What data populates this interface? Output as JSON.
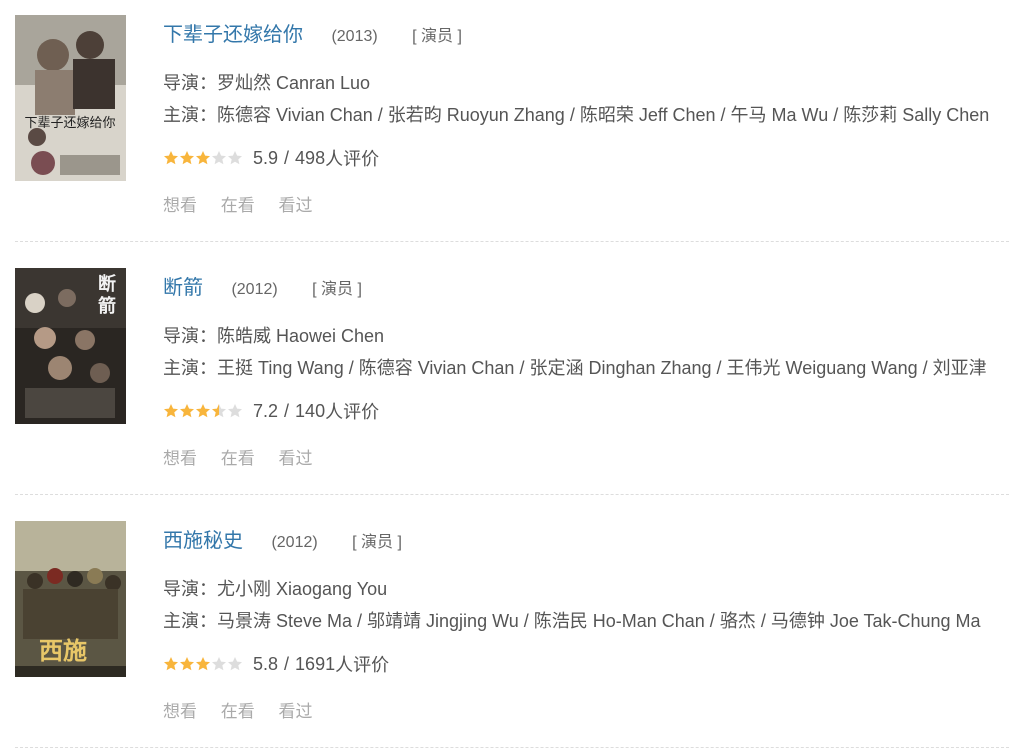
{
  "labels": {
    "director_prefix": "导演：",
    "cast_prefix": "主演：",
    "slash": "/",
    "rating_suffix": "人评价",
    "want": "想看",
    "watching": "在看",
    "watched": "看过"
  },
  "colors": {
    "title_link": "#3377aa",
    "star_on": "#f8b53c",
    "star_off": "#dddddd",
    "action_text": "#aaaaaa",
    "separator": "#dddddd"
  },
  "items": [
    {
      "title": "下辈子还嫁给你",
      "year": "(2013)",
      "role": "[ 演员 ]",
      "director": "罗灿然 Canran Luo",
      "cast": "陈德容 Vivian Chan / 张若昀 Ruoyun Zhang / 陈昭荣 Jeff Chen / 午马 Ma Wu / 陈莎莉 Sally Chen",
      "score": "5.9",
      "votes": "498",
      "stars_out_of_5": 3
    },
    {
      "title": "断箭",
      "year": "(2012)",
      "role": "[ 演员 ]",
      "director": "陈皓威 Haowei Chen",
      "cast": "王挺 Ting Wang / 陈德容 Vivian Chan / 张定涵 Dinghan Zhang / 王伟光 Weiguang Wang / 刘亚津",
      "score": "7.2",
      "votes": "140",
      "stars_out_of_5": 3.5
    },
    {
      "title": "西施秘史",
      "year": "(2012)",
      "role": "[ 演员 ]",
      "director": "尤小刚 Xiaogang You",
      "cast": "马景涛 Steve Ma / 邬靖靖 Jingjing Wu / 陈浩民 Ho-Man Chan / 骆杰 / 马德钟 Joe Tak-Chung Ma",
      "score": "5.8",
      "votes": "1691",
      "stars_out_of_5": 3
    }
  ]
}
